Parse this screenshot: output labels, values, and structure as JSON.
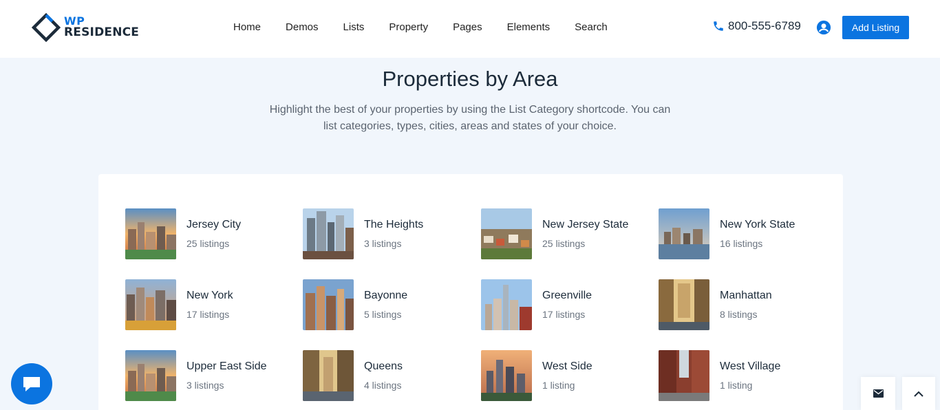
{
  "brand": {
    "wp": "WP",
    "residence": "RESIDENCE"
  },
  "nav": [
    {
      "label": "Home"
    },
    {
      "label": "Demos"
    },
    {
      "label": "Lists"
    },
    {
      "label": "Property"
    },
    {
      "label": "Pages"
    },
    {
      "label": "Elements"
    },
    {
      "label": "Search"
    }
  ],
  "header": {
    "phone": "800-555-6789",
    "add_listing": "Add Listing",
    "phone_icon": "phone-icon",
    "user_icon": "user-icon"
  },
  "section": {
    "title": "Properties by Area",
    "description_line1": "Highlight the best of your properties by using the List Category shortcode. You can",
    "description_line2": "list categories, types, cities, areas and states of your choice."
  },
  "areas": [
    {
      "name": "Jersey City",
      "count": "25 listings"
    },
    {
      "name": "The Heights",
      "count": "3 listings"
    },
    {
      "name": "New Jersey State",
      "count": "25 listings"
    },
    {
      "name": "New York State",
      "count": "16 listings"
    },
    {
      "name": "New York",
      "count": "17 listings"
    },
    {
      "name": "Bayonne",
      "count": "5 listings"
    },
    {
      "name": "Greenville",
      "count": "17 listings"
    },
    {
      "name": "Manhattan",
      "count": "8 listings"
    },
    {
      "name": "Upper East Side",
      "count": "3 listings"
    },
    {
      "name": "Queens",
      "count": "4 listings"
    },
    {
      "name": "West Side",
      "count": "1 listing"
    },
    {
      "name": "West Village",
      "count": "1 listing"
    }
  ],
  "floating": {
    "chat_icon": "chat-icon",
    "mail_icon": "mail-icon",
    "up_icon": "chevron-up-icon"
  },
  "colors": {
    "accent": "#0b74e0",
    "background": "#f1f6fc"
  }
}
